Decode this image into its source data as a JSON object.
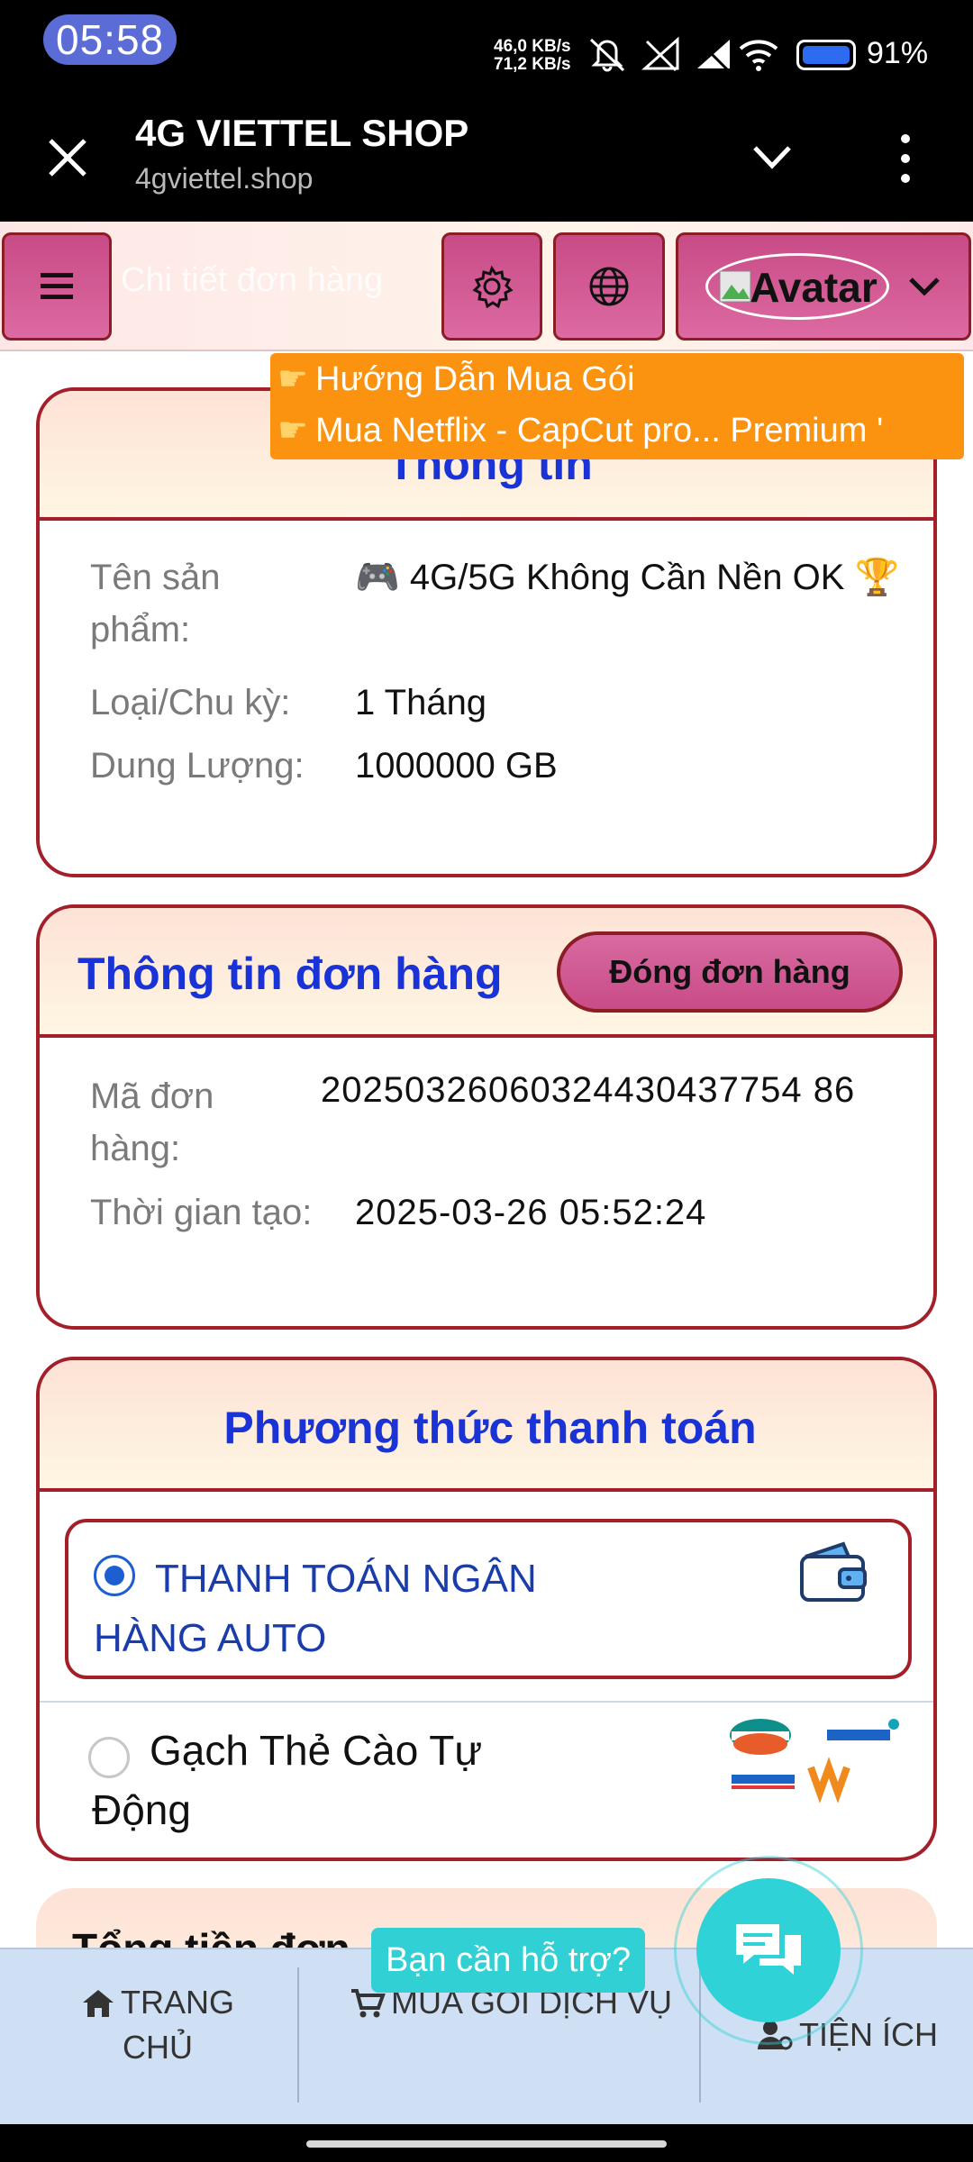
{
  "status_bar": {
    "time": "05:58",
    "net_up": "46,0 KB/s",
    "net_down": "71,2 KB/s",
    "battery_pct": "91%",
    "icons": [
      "mute-icon",
      "signal-off-icon",
      "signal-off-icon",
      "wifi-icon",
      "battery-icon"
    ]
  },
  "browser": {
    "title": "4G VIETTEL SHOP",
    "url": "4gviettel.shop"
  },
  "header": {
    "page_title": "Chi tiết đơn hàng",
    "avatar_label": "Avatar"
  },
  "notice": {
    "line1": "Hướng Dẫn Mua Gói",
    "line2": "Mua Netflix - CapCut pro... Premium '"
  },
  "product_card": {
    "title": "Thông tin",
    "name_label": "Tên sản phẩm:",
    "name_value": "🎮 4G/5G Không Cần Nền OK 🏆",
    "type_label": "Loại/Chu kỳ:",
    "type_value": "1 Tháng",
    "capacity_label": "Dung Lượng:",
    "capacity_value": "1000000 GB"
  },
  "order_card": {
    "title": "Thông tin đơn hàng",
    "close_button": "Đóng đơn hàng",
    "code_label": "Mã đơn hàng:",
    "code_value": "20250326060324430437754 86",
    "created_label": "Thời gian tạo:",
    "created_value": "2025-03-26 05:52:24"
  },
  "payment_card": {
    "title": "Phương thức thanh toán",
    "option1": "THANH TOÁN NGÂN HÀNG AUTO",
    "option2": "Gạch Thẻ Cào Tự Động",
    "selected": "option1"
  },
  "total_card": {
    "title": "Tổng tiền đơn"
  },
  "bottom_nav": {
    "home": "TRANG CHỦ",
    "buy": "MUA GÓI DỊCH VỤ",
    "utilities": "TIỆN ÍCH"
  },
  "support": {
    "label": "Bạn cần hỗ trợ?"
  },
  "colors": {
    "accent_blue": "#1a33d6",
    "border_red": "#a3202a",
    "button_pink": "#c84b86",
    "notice_orange": "#fb9310",
    "support_cyan": "#31d0d4"
  }
}
